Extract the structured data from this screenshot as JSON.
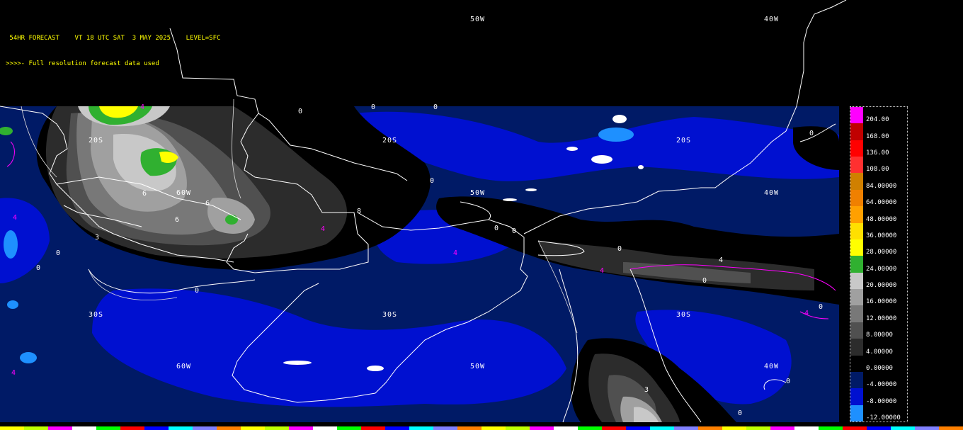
{
  "header": {
    "line1": " 54HR FORECAST    VT 18 UTC SAT  3 MAY 2025    LEVEL=SFC",
    "line2": ">>>>- Full resolution forecast data used"
  },
  "lon_labels_top": [
    "50W",
    "40W"
  ],
  "grid_labels": {
    "lat_20s": "20S",
    "lat_30s": "30S",
    "lon_60w": "60W",
    "lon_50w": "50W",
    "lon_40w": "40W"
  },
  "contour_labels": {
    "zero": "0",
    "four": "4",
    "six": "6",
    "three": "3",
    "eight": "8"
  },
  "colorbar": {
    "levels": [
      {
        "label": "204.00",
        "color": "#ff00ff"
      },
      {
        "label": "168.00",
        "color": "#c00000"
      },
      {
        "label": "136.00",
        "color": "#ff0000"
      },
      {
        "label": "108.00",
        "color": "#ff3030"
      },
      {
        "label": "84.00000",
        "color": "#d08000"
      },
      {
        "label": "64.00000",
        "color": "#f08000"
      },
      {
        "label": "48.00000",
        "color": "#ffa000"
      },
      {
        "label": "36.00000",
        "color": "#ffe000"
      },
      {
        "label": "28.00000",
        "color": "#ffff00"
      },
      {
        "label": "24.00000",
        "color": "#30b030"
      },
      {
        "label": "20.00000",
        "color": "#c8c8c8"
      },
      {
        "label": "16.00000",
        "color": "#a0a0a0"
      },
      {
        "label": "12.00000",
        "color": "#787878"
      },
      {
        "label": "8.00000",
        "color": "#505050"
      },
      {
        "label": "4.00000",
        "color": "#2c2c2c"
      },
      {
        "label": "0.00000",
        "color": "#000000"
      },
      {
        "label": "-4.00000",
        "color": "#001a66"
      },
      {
        "label": "-8.00000",
        "color": "#0010d0"
      },
      {
        "label": "-12.00000",
        "color": "#1e90ff"
      }
    ]
  },
  "colors": {
    "background": "#000000",
    "ocean_blue": "#0010d0",
    "dark_blue": "#001a66",
    "header_text": "#ffff00",
    "contour_magenta": "#ff00ff",
    "coastline": "#ffffff"
  }
}
